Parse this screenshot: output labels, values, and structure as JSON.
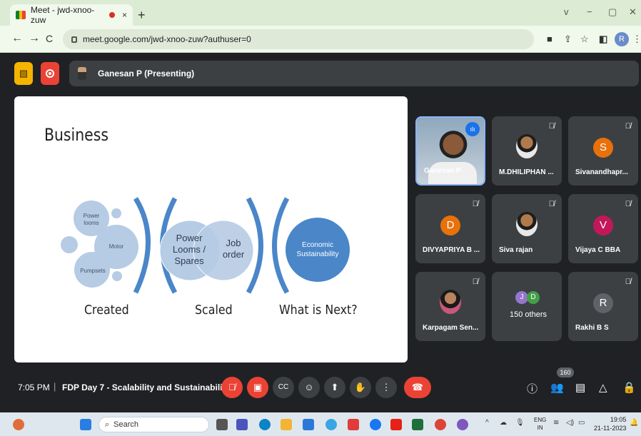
{
  "browser": {
    "tab_title": "Meet - jwd-xnoo-zuw",
    "tab_close": "×",
    "new_tab": "+",
    "window_controls": [
      "v",
      "−",
      "▢",
      "✕"
    ],
    "url": "meet.google.com/jwd-xnoo-zuw?authuser=0",
    "nav": [
      "←",
      "→",
      "C"
    ],
    "profile_initial": "R"
  },
  "meet": {
    "presenter_banner": "Ganesan P (Presenting)",
    "slide": {
      "title": "Business",
      "bubbles": [
        "Power looms",
        "Motor",
        "Pumpsets"
      ],
      "scaled_left": "Power Looms / Spares",
      "scaled_right": "Job order",
      "economic": "Economic Sustainability",
      "labels": [
        "Created",
        "Scaled",
        "What is Next?"
      ]
    },
    "participants": [
      {
        "name": "Ganesan P",
        "type": "video",
        "speaking": true
      },
      {
        "name": "M.DHILIPHAN ...",
        "type": "photo",
        "muted": true
      },
      {
        "name": "Sivanandhapr...",
        "type": "letter",
        "letter": "S",
        "color": "#e8710a",
        "muted": true
      },
      {
        "name": "DIVYAPRIYA B ...",
        "type": "letter",
        "letter": "D",
        "color": "#e8710a",
        "muted": true
      },
      {
        "name": "Siva rajan",
        "type": "photo",
        "muted": true
      },
      {
        "name": "Vijaya C BBA",
        "type": "letter",
        "letter": "V",
        "color": "#c2185b",
        "muted": true
      },
      {
        "name": "Karpagam Sen...",
        "type": "photo",
        "muted": true
      },
      {
        "name": "150 others",
        "type": "others",
        "dots": [
          "J",
          "D"
        ],
        "dot_colors": [
          "#9575cd",
          "#43a047"
        ]
      },
      {
        "name": "Rakhi B S",
        "type": "letter",
        "letter": "R",
        "color": "#5f6368",
        "muted": true
      }
    ],
    "bottom": {
      "time": "7:05 PM",
      "separator": "|",
      "meeting_title": "FDP Day 7 - Scalability and Sustainabili...",
      "people_count": "160"
    }
  },
  "taskbar": {
    "search_placeholder": "Search",
    "language": "ENG",
    "language_sub": "IN",
    "time": "19:05",
    "date": "21-11-2023"
  },
  "colors": {
    "meet_bg": "#202124",
    "tile_bg": "#3c4043",
    "red": "#ea4335",
    "slide_blue": "#4a86c8"
  }
}
